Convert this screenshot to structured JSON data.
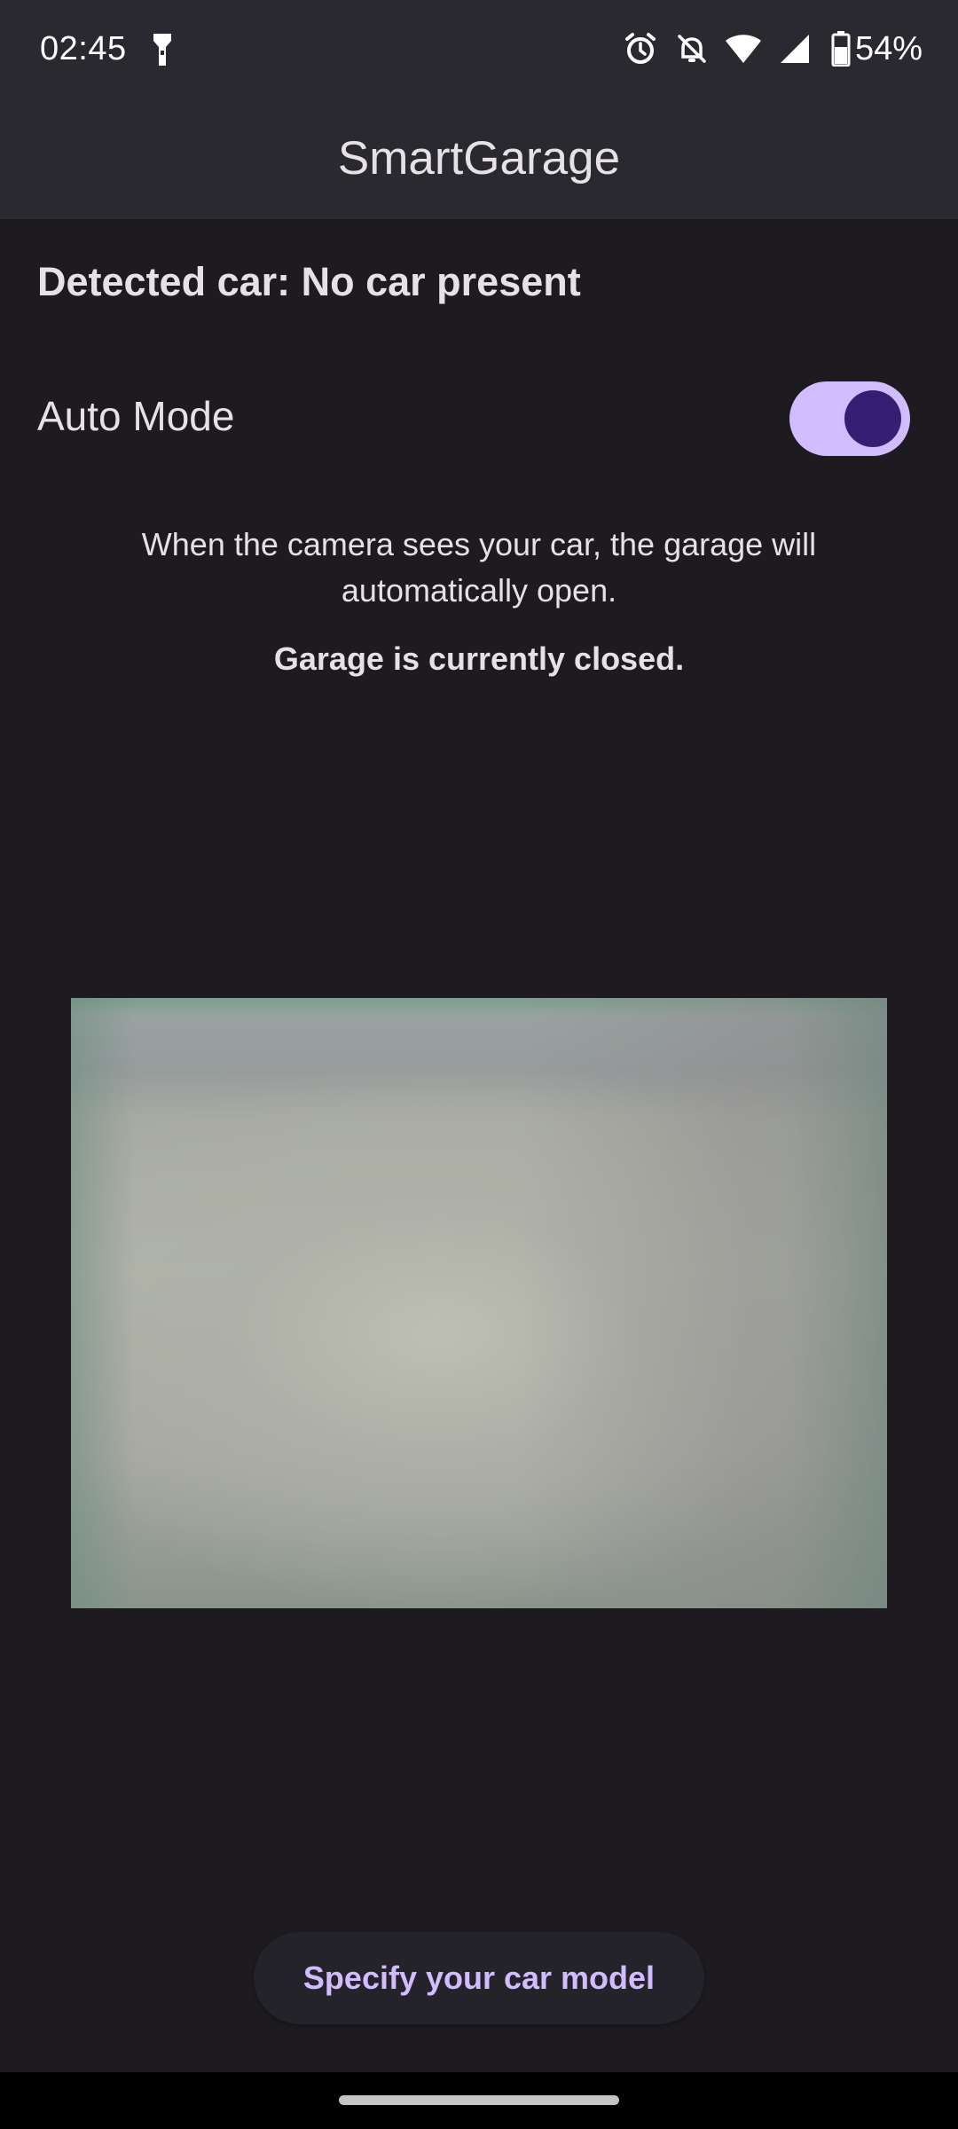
{
  "status_bar": {
    "time": "02:45",
    "left_icons": [
      "flashlight-icon"
    ],
    "right_icons": [
      "alarm-icon",
      "notifications-off-icon",
      "wifi-icon",
      "cellular-signal-icon",
      "battery-icon"
    ],
    "battery_percent": "54%"
  },
  "app_bar": {
    "title": "SmartGarage"
  },
  "main": {
    "detected_text": "Detected car: No car present",
    "auto_mode_label": "Auto Mode",
    "auto_mode_enabled": true,
    "description": "When the camera sees your car, the garage will automatically open.",
    "garage_status": "Garage is currently closed.",
    "specify_button_label": "Specify your car model"
  },
  "colors": {
    "background": "#1d1b20",
    "app_bar": "#2b2930",
    "accent": "#d0bcff",
    "toggle_knob": "#381e72",
    "text": "#e6e1e5"
  }
}
